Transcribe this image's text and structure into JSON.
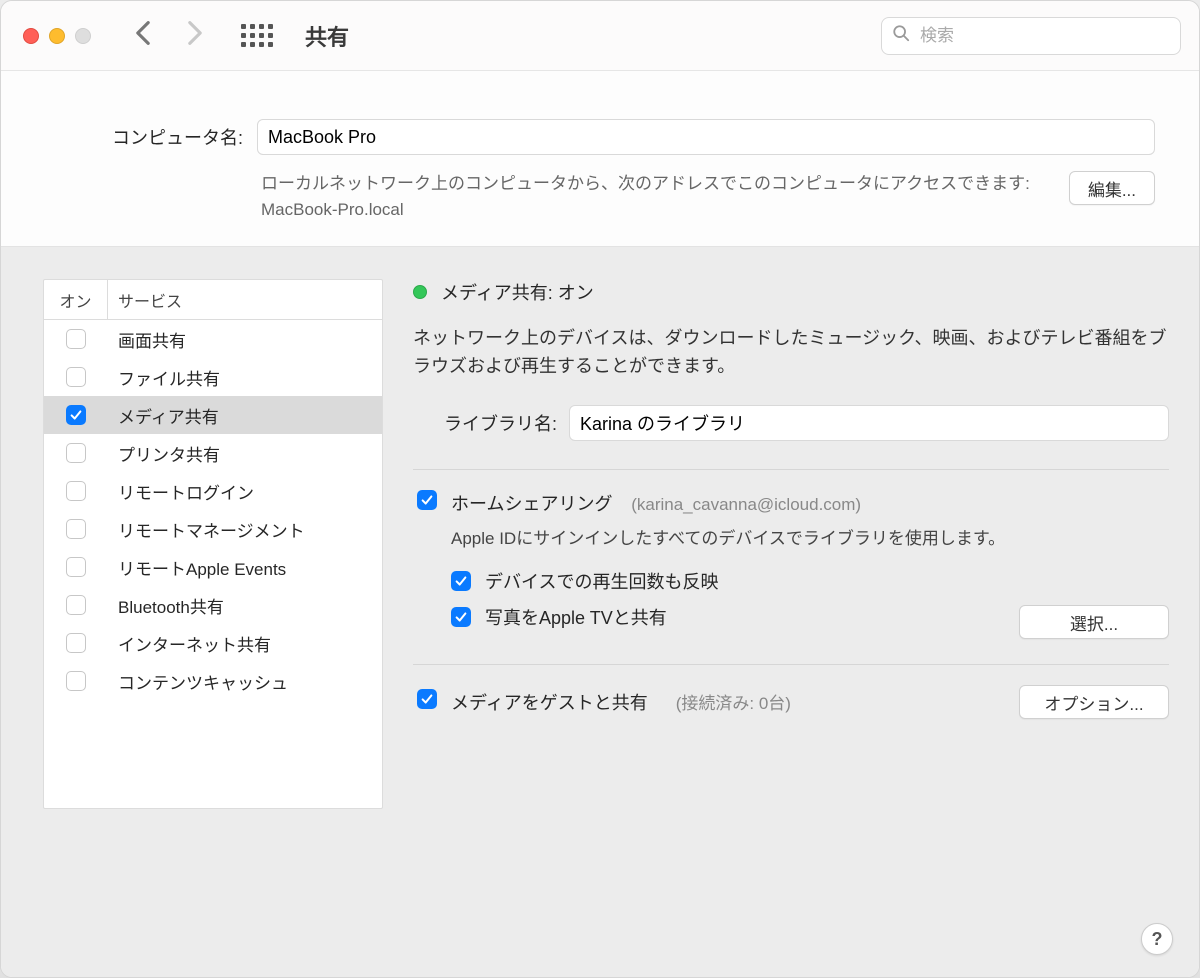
{
  "titlebar": {
    "title": "共有",
    "search_placeholder": "検索"
  },
  "top": {
    "computer_name_label": "コンピュータ名:",
    "computer_name_value": "MacBook Pro",
    "description": "ローカルネットワーク上のコンピュータから、次のアドレスでこのコンピュータにアクセスできます: MacBook-Pro.local",
    "edit_button": "編集..."
  },
  "sidebar": {
    "col_on": "オン",
    "col_service": "サービス",
    "items": [
      {
        "label": "画面共有",
        "checked": false,
        "selected": false
      },
      {
        "label": "ファイル共有",
        "checked": false,
        "selected": false
      },
      {
        "label": "メディア共有",
        "checked": true,
        "selected": true
      },
      {
        "label": "プリンタ共有",
        "checked": false,
        "selected": false
      },
      {
        "label": "リモートログイン",
        "checked": false,
        "selected": false
      },
      {
        "label": "リモートマネージメント",
        "checked": false,
        "selected": false
      },
      {
        "label": "リモートApple Events",
        "checked": false,
        "selected": false
      },
      {
        "label": "Bluetooth共有",
        "checked": false,
        "selected": false
      },
      {
        "label": "インターネット共有",
        "checked": false,
        "selected": false
      },
      {
        "label": "コンテンツキャッシュ",
        "checked": false,
        "selected": false
      }
    ]
  },
  "detail": {
    "status_text": "メディア共有: オン",
    "description": "ネットワーク上のデバイスは、ダウンロードしたミュージック、映画、およびテレビ番組をブラウズおよび再生することができます。",
    "library_label": "ライブラリ名:",
    "library_value": "Karina のライブラリ",
    "home_sharing": {
      "label": "ホームシェアリング",
      "account": "(karina_cavanna@icloud.com)",
      "desc": "Apple IDにサインインしたすべてのデバイスでライブラリを使用します。",
      "opt_playcount": "デバイスでの再生回数も反映",
      "opt_photos": "写真をApple TVと共有",
      "select_button": "選択..."
    },
    "guest": {
      "label": "メディアをゲストと共有",
      "status": "(接続済み: 0台)",
      "options_button": "オプション..."
    }
  },
  "help": "?"
}
